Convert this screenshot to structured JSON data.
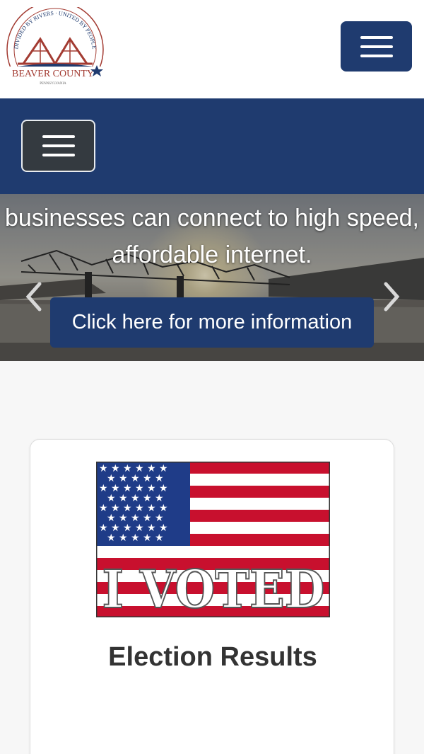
{
  "header": {
    "logo_arc_text": "DIVIDED BY RIVERS · UNITED BY PEOPLE",
    "logo_name": "BEAVER COUNTY",
    "logo_state": "PENNSYLVANIA",
    "menu_icon": "hamburger-menu-icon"
  },
  "nav": {
    "menu_icon": "hamburger-menu-icon"
  },
  "hero": {
    "text_line1": "businesses can connect to high speed,",
    "text_line2": "affordable internet.",
    "button_label": "Click here for more information",
    "prev_icon": "chevron-left-icon",
    "next_icon": "chevron-right-icon"
  },
  "card": {
    "image_text": "I VOTED",
    "title": "Election Results"
  },
  "colors": {
    "brand_navy": "#1f3b6f",
    "nav_toggle_dark": "#343a40",
    "flag_red": "#c8102e",
    "flag_blue": "#1f3c88"
  }
}
